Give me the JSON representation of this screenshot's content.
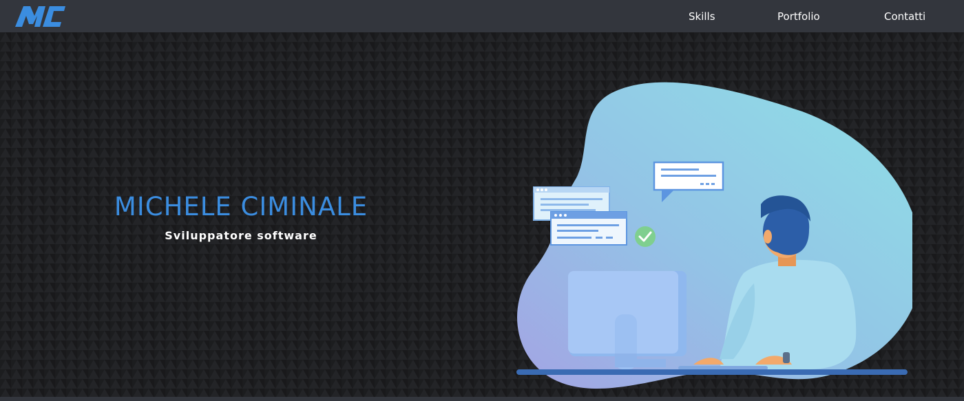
{
  "nav": {
    "logo_text": "MC",
    "links": [
      "Skills",
      "Portfolio",
      "Contatti"
    ]
  },
  "hero": {
    "name": "MICHELE CIMINALE",
    "role": "Sviluppatore software"
  },
  "illustration": {
    "subject": "developer-at-computer",
    "colors": {
      "blob_start": "#8fe0e6",
      "blob_end": "#9aa8e6",
      "skin": "#f2a96b",
      "hair": "#2c5ea8",
      "shirt": "#a9dcef",
      "monitor": "#a7c7f5",
      "desk": "#3a6bb3",
      "check": "#7fcf8f"
    }
  },
  "theme": {
    "navbar_bg": "#33363d",
    "page_bg": "#1c1d1f",
    "accent": "#3b8de0",
    "text": "#ffffff"
  }
}
